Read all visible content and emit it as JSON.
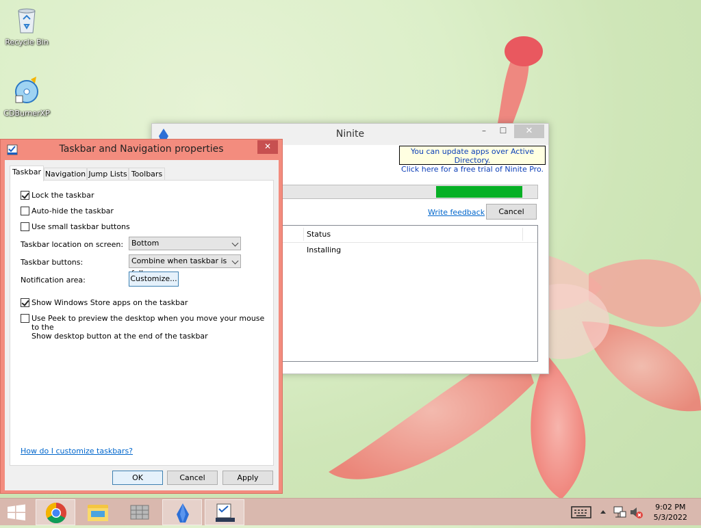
{
  "desktop": {
    "icons": [
      {
        "label": "Recycle Bin",
        "icon": "recycle-bin-icon"
      },
      {
        "label": "CDBurnerXP",
        "icon": "cd-burner-icon"
      }
    ]
  },
  "ninite": {
    "title": "Ninite",
    "ad_line1": "You can update apps over Active Directory.",
    "ad_line2": "Click here for a free trial of Ninite Pro.",
    "progress_fraction": 0.34,
    "feedback_link": "Write feedback",
    "cancel_label": "Cancel",
    "list_header_status": "Status",
    "list_rows": [
      {
        "status": "Installing"
      }
    ],
    "controls": {
      "minimize": "–",
      "maximize": "☐",
      "close": "✕"
    }
  },
  "dialog": {
    "title": "Taskbar and Navigation properties",
    "close": "✕",
    "tabs": [
      "Taskbar",
      "Navigation",
      "Jump Lists",
      "Toolbars"
    ],
    "active_tab": "Taskbar",
    "checkboxes": {
      "lock": {
        "label": "Lock the taskbar",
        "checked": true
      },
      "autohide": {
        "label": "Auto-hide the taskbar",
        "checked": false
      },
      "small_buttons": {
        "label": "Use small taskbar buttons",
        "checked": false
      },
      "store_apps": {
        "label": "Show Windows Store apps on the taskbar",
        "checked": true
      },
      "peek_line1": "Use Peek to preview the desktop when you move your mouse to the",
      "peek_line2": "Show desktop button at the end of the taskbar",
      "peek_checked": false
    },
    "location_label": "Taskbar location on screen:",
    "location_value": "Bottom",
    "buttons_label": "Taskbar buttons:",
    "buttons_value": "Combine when taskbar is full",
    "notification_label": "Notification area:",
    "customize_button": "Customize...",
    "help_link": "How do I customize taskbars?",
    "ok": "OK",
    "cancel": "Cancel",
    "apply": "Apply"
  },
  "taskbar": {
    "items": [
      "start-button",
      "chrome",
      "file-explorer",
      "app-grid",
      "ninite",
      "taskbar-properties"
    ],
    "clock_time": "9:02 PM",
    "clock_date": "5/3/2022",
    "colors": {
      "taskbar": "#d9b8ae",
      "accent": "#f38c7e",
      "progress": "#06b025"
    }
  }
}
